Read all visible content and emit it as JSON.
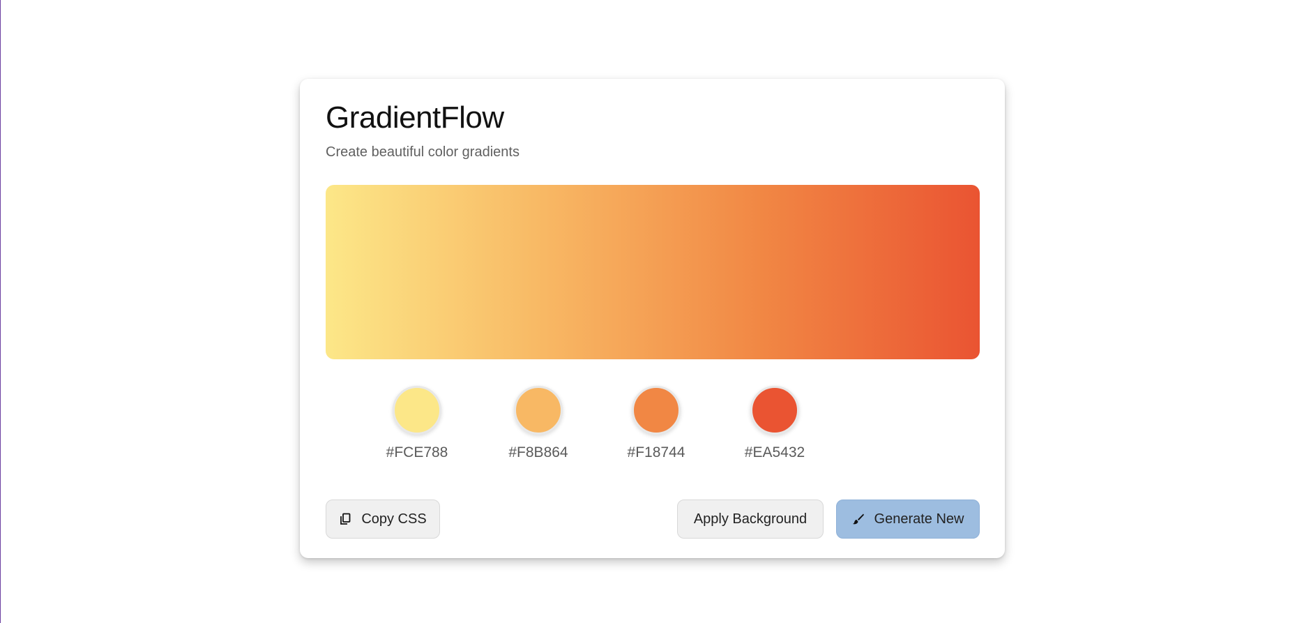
{
  "app": {
    "title": "GradientFlow",
    "subtitle": "Create beautiful color gradients"
  },
  "gradient": {
    "direction": "to right",
    "stops": [
      "#FCE788",
      "#F8B864",
      "#F18744",
      "#EA5432"
    ]
  },
  "swatches": [
    {
      "hex": "#FCE788",
      "color": "#FCE788"
    },
    {
      "hex": "#F8B864",
      "color": "#F8B864"
    },
    {
      "hex": "#F18744",
      "color": "#F18744"
    },
    {
      "hex": "#EA5432",
      "color": "#EA5432"
    }
  ],
  "buttons": {
    "copy_label": "Copy CSS",
    "copy_icon": "copy-icon",
    "apply_label": "Apply Background",
    "generate_label": "Generate New",
    "generate_icon": "brush-icon"
  },
  "colors": {
    "accent": "#9DBDE0",
    "text": "#111111",
    "muted": "#606060"
  }
}
